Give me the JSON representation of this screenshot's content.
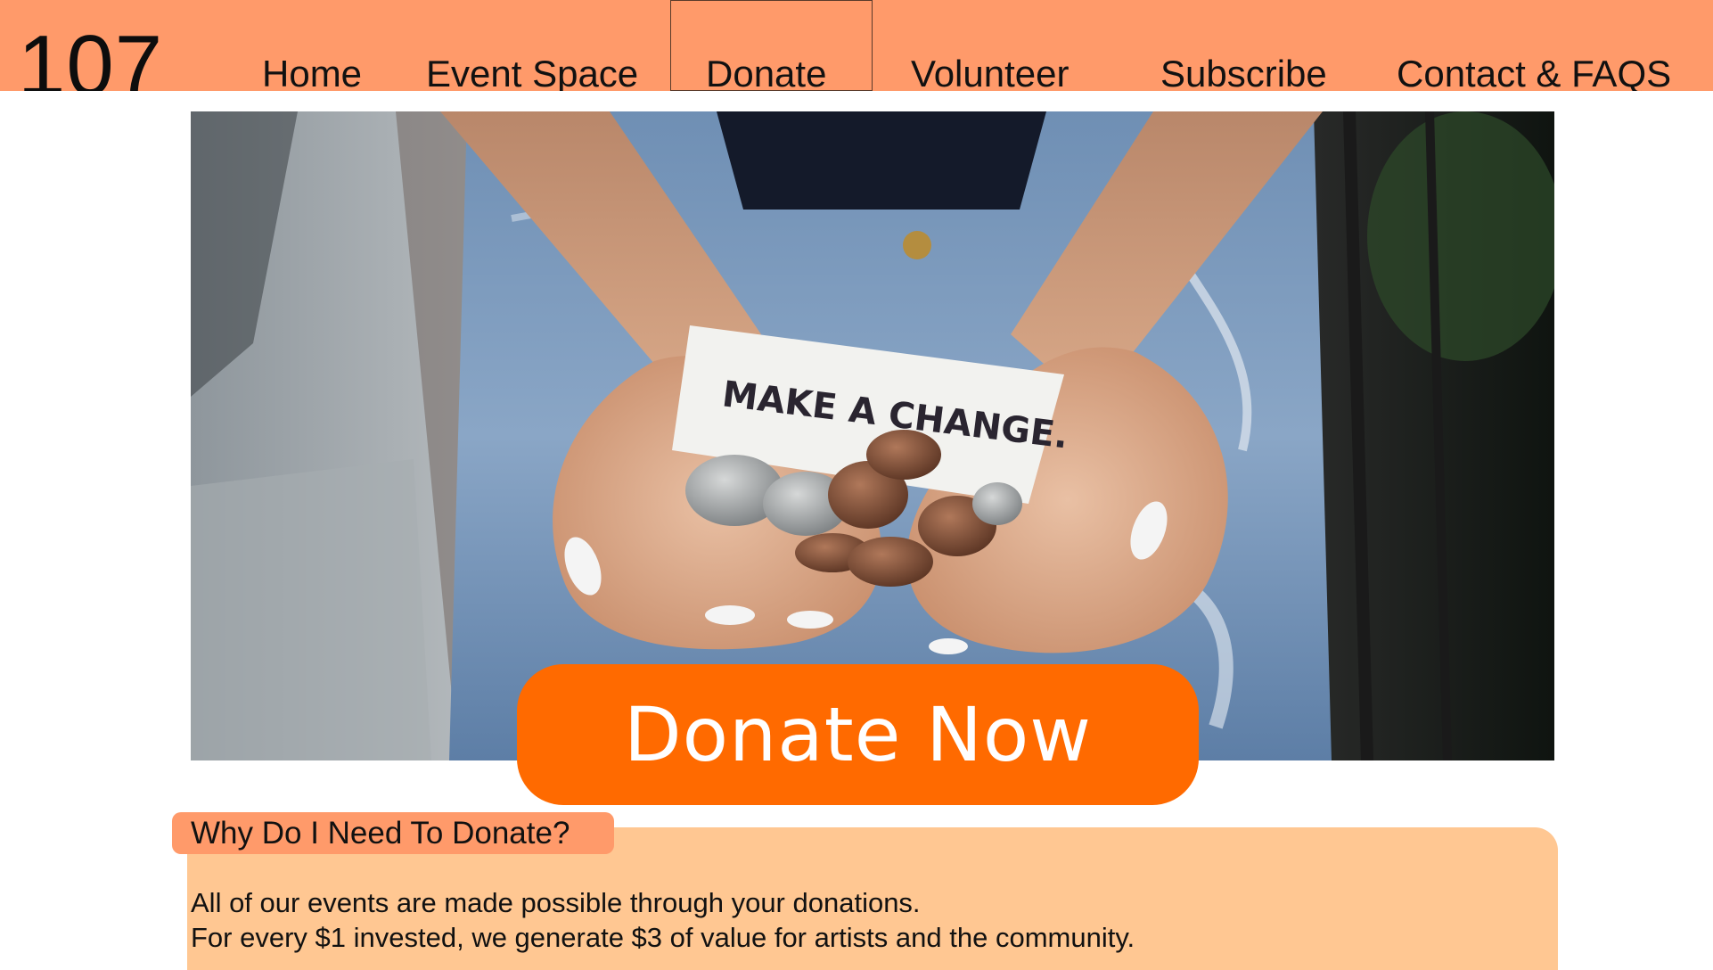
{
  "header": {
    "logo": "107",
    "nav": [
      {
        "label": "Home"
      },
      {
        "label": "Event Space"
      },
      {
        "label": "Donate"
      },
      {
        "label": "Volunteer"
      },
      {
        "label": "Subscribe"
      },
      {
        "label": "Contact & FAQS"
      }
    ]
  },
  "hero": {
    "note_text": "MAKE A CHANGE.",
    "cta_label": "Donate Now"
  },
  "info": {
    "heading": "Why Do I Need To Donate?",
    "lines": [
      "All of our events are made possible through your donations.",
      "For every $1 invested, we generate $3 of value for artists and the community."
    ]
  },
  "colors": {
    "header_bg": "#FF9A6A",
    "cta_bg": "#FF6A00",
    "card_bg": "#FFC792"
  },
  "icons": {
    "hero_image": "hands-holding-coins-image"
  }
}
